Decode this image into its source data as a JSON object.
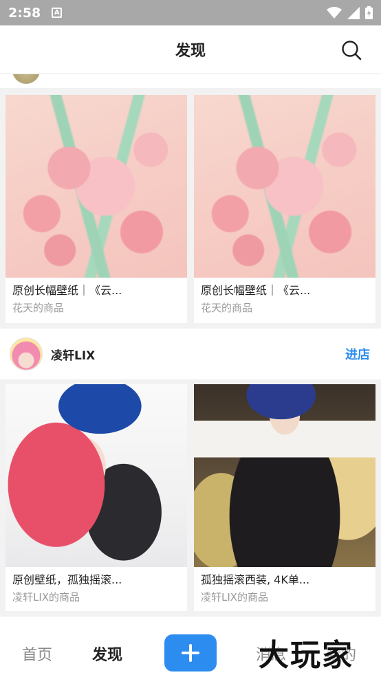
{
  "status_bar": {
    "time": "2:58",
    "notification_icon": "A"
  },
  "header": {
    "title": "发现",
    "search_icon": "search-icon"
  },
  "rows": [
    {
      "cards": [
        {
          "title": "原创长幅壁纸｜《云...",
          "seller": "花天的商品",
          "image": "pink floral illustration with rabbits"
        },
        {
          "title": "原创长幅壁纸｜《云...",
          "seller": "花天的商品",
          "image": "pink floral illustration with rabbits"
        }
      ]
    }
  ],
  "shop": {
    "name": "凌轩LIX",
    "enter_label": "进店",
    "cards": [
      {
        "title": "原创壁纸，孤独摇滚...",
        "seller": "凌轩LIX的商品",
        "image": "anime couple, pink and blue hair"
      },
      {
        "title": "孤独摇滚西装, 4K单...",
        "seller": "凌轩LIX的商品",
        "image": "anime character in black suit"
      }
    ]
  },
  "tab_bar": {
    "home": "首页",
    "discover": "发现",
    "add_icon": "plus-icon",
    "messages": "消息",
    "me": "我的"
  },
  "watermark": "大玩家",
  "colors": {
    "accent": "#2d8cf0",
    "status_bar": "#a8a8a8",
    "background": "#f2f2f2"
  }
}
